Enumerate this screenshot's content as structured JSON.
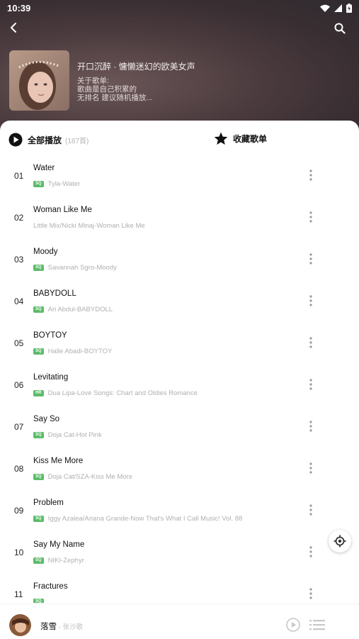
{
  "status": {
    "time": "10:39"
  },
  "playlist": {
    "title": "开口沉醉 · 慵懒迷幻的欧美女声",
    "desc_label": "关于歌单:",
    "desc_line1": "歌曲是自己积累的",
    "desc_line2": "无排名 建议随机播放..."
  },
  "actions": {
    "play_all_label": "全部播放",
    "count": "(187首)",
    "favorite_label": "收藏歌单"
  },
  "songs": [
    {
      "num": "01",
      "title": "Water",
      "quality": "SQ",
      "artist": "Tyla-Water"
    },
    {
      "num": "02",
      "title": "Woman Like Me",
      "quality": "",
      "artist": "Little Mix/Nicki Minaj-Woman Like Me"
    },
    {
      "num": "03",
      "title": "Moody",
      "quality": "SQ",
      "artist": "Savannah Sgro-Moody"
    },
    {
      "num": "04",
      "title": "BABYDOLL",
      "quality": "SQ",
      "artist": "Ari Abdul-BABYDOLL"
    },
    {
      "num": "05",
      "title": "BOYTOY",
      "quality": "SQ",
      "artist": "Halle Abadi-BOYTOY"
    },
    {
      "num": "06",
      "title": "Levitating",
      "quality": "HR",
      "artist": "Dua Lipa-Love Songs: Chart and Oldies Romance"
    },
    {
      "num": "07",
      "title": "Say So",
      "quality": "SQ",
      "artist": "Doja Cat-Hot Pink"
    },
    {
      "num": "08",
      "title": "Kiss Me More",
      "quality": "SQ",
      "artist": "Doja Cat/SZA-Kiss Me More"
    },
    {
      "num": "09",
      "title": "Problem",
      "quality": "SQ",
      "artist": "Iggy Azalea/Ariana Grande-Now That's What I Call Music! Vol. 88"
    },
    {
      "num": "10",
      "title": "Say My Name",
      "quality": "SQ",
      "artist": "NIKI-Zephyr"
    },
    {
      "num": "11",
      "title": "Fractures",
      "quality": "SQ",
      "artist": ""
    }
  ],
  "player": {
    "song": "落雪",
    "separator": " - ",
    "artist": "张沙歌"
  },
  "colors": {
    "badge": "#5dbb6a",
    "header_bg": "#4a3a3d"
  },
  "icons": {
    "back": "chevron-left-icon",
    "search": "search-icon",
    "play_all": "play-circle-icon",
    "favorite": "star-icon",
    "more": "more-vertical-icon",
    "locate": "locate-icon",
    "player_play": "play-icon",
    "playlist": "playlist-icon"
  }
}
